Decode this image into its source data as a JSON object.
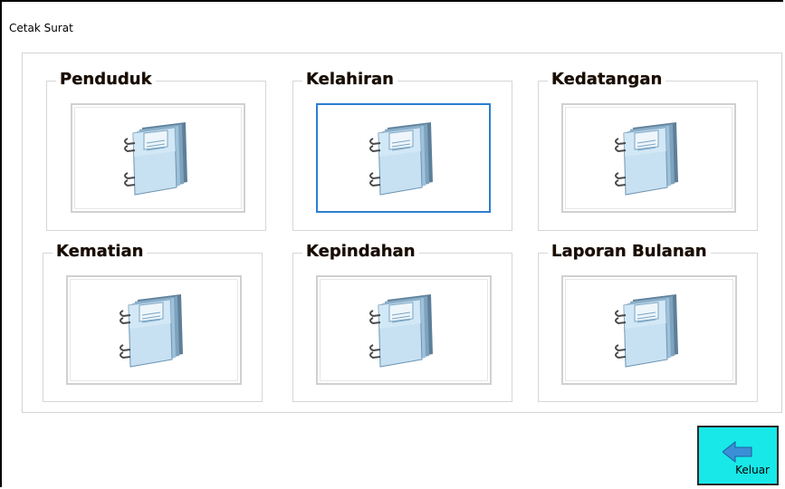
{
  "window": {
    "title": "Cetak Surat"
  },
  "groups": [
    {
      "label": "Penduduk"
    },
    {
      "label": "Kelahiran"
    },
    {
      "label": "Kedatangan"
    },
    {
      "label": "Kematian"
    },
    {
      "label": "Kepindahan"
    },
    {
      "label": "Laporan Bulanan"
    }
  ],
  "icons": {
    "report": "notebook-icon",
    "exit": "arrow-left-icon"
  },
  "exit_button": {
    "label": "Keluar"
  },
  "colors": {
    "selected_border": "#2b7fd0",
    "exit_bg": "#18e8e8",
    "book": "#a9d2ec"
  }
}
